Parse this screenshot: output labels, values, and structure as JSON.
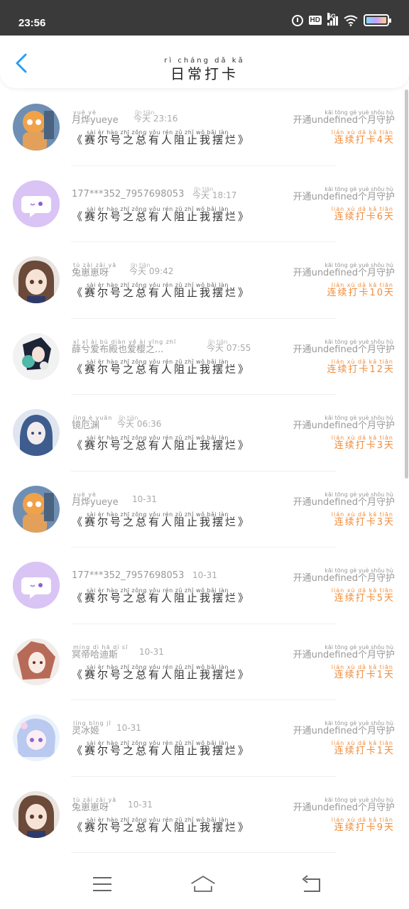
{
  "status": {
    "time": "23:56",
    "hd": "HD",
    "network": "5G"
  },
  "header": {
    "title": "日常打卡",
    "title_ruby": "rì cháng dǎ kǎ"
  },
  "rule_text": "《赛尔号之总有人阻止我摆烂》",
  "rule_ruby": "sài  èr  hào zhī zǒng yǒu rén  zǔ  zhǐ  wǒ  bǎi  làn",
  "membership_ruby": "kāi tōng             gè  yuè shǒu hù",
  "streak_ruby": "lián  xù   dǎ   kǎ    tiān",
  "items": [
    {
      "name": "月烨yueye",
      "name_ruby": "yuè yè",
      "time": "今天 23:16",
      "time_ruby": "jīn tiān",
      "membership": "开通undefined个月守护",
      "streak": "连续打卡4天"
    },
    {
      "name": "177***352_7957698053",
      "name_ruby": "",
      "time": "今天 18:17",
      "time_ruby": "jīn tiān",
      "membership": "开通undefined个月守护",
      "streak": "连续打卡6天"
    },
    {
      "name": "兔崽崽呀",
      "name_ruby": "tù zǎi zǎi yā",
      "time": "今天 09:42",
      "time_ruby": "jīn tiān",
      "membership": "开通undefined个月守护",
      "streak": "连续打卡10天"
    },
    {
      "name": "薛兮爱布殿也爱樱之...",
      "name_ruby": "xī  xī  ài  bù diàn yě  ài yīng zhī",
      "time": "今天 07:55",
      "time_ruby": "jīn tiān",
      "membership": "开通undefined个月守护",
      "streak": "连续打卡12天"
    },
    {
      "name": "镜厄渊",
      "name_ruby": "jìng è yuān",
      "time": "今天 06:36",
      "time_ruby": "jīn tiān",
      "membership": "开通undefined个月守护",
      "streak": "连续打卡3天"
    },
    {
      "name": "月烨yueye",
      "name_ruby": "yuè yè",
      "time": "10-31",
      "time_ruby": "",
      "membership": "开通undefined个月守护",
      "streak": "连续打卡3天"
    },
    {
      "name": "177***352_7957698053",
      "name_ruby": "",
      "time": "10-31",
      "time_ruby": "",
      "membership": "开通undefined个月守护",
      "streak": "连续打卡5天"
    },
    {
      "name": "冥帝哈迪斯",
      "name_ruby": "míng dì hā dí sī",
      "time": "10-31",
      "time_ruby": "",
      "membership": "开通undefined个月守护",
      "streak": "连续打卡1天"
    },
    {
      "name": "灵冰姬",
      "name_ruby": "líng bīng jī",
      "time": "10-31",
      "time_ruby": "",
      "membership": "开通undefined个月守护",
      "streak": "连续打卡1天"
    },
    {
      "name": "兔崽崽呀",
      "name_ruby": "tù zǎi zǎi yā",
      "time": "10-31",
      "time_ruby": "",
      "membership": "开通undefined个月守护",
      "streak": "连续打卡9天"
    }
  ]
}
